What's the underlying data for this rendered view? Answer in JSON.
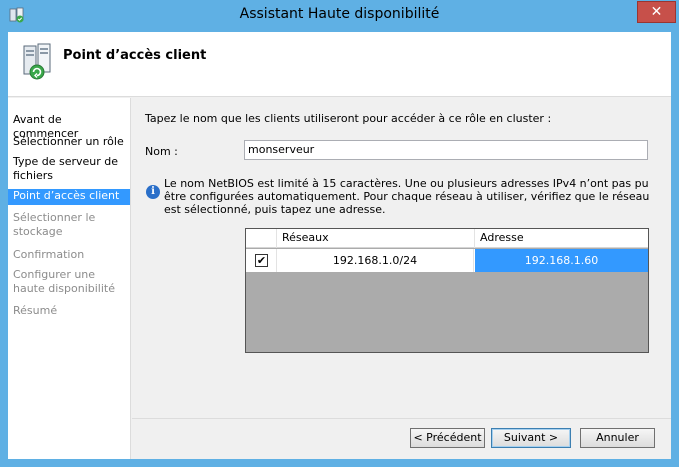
{
  "window": {
    "title": "Assistant Haute disponibilité",
    "close_glyph": "✕"
  },
  "header": {
    "title": "Point d’accès client",
    "icon": "cluster-server-icon"
  },
  "nav": {
    "items": [
      {
        "label": "Avant de commencer",
        "state": "done"
      },
      {
        "label": "Sélectionner un rôle",
        "state": "done"
      },
      {
        "label": "Type de serveur de fichiers",
        "state": "done"
      },
      {
        "label": "Point d’accès client",
        "state": "active"
      },
      {
        "label": "Sélectionner le stockage",
        "state": "disabled"
      },
      {
        "label": "Confirmation",
        "state": "disabled"
      },
      {
        "label": "Configurer une haute disponibilité",
        "state": "disabled"
      },
      {
        "label": "Résumé",
        "state": "disabled"
      }
    ]
  },
  "content": {
    "intro": "Tapez le nom que les clients utiliseront pour accéder à ce rôle en cluster :",
    "name_label": "Nom :",
    "name_value": "monserveur",
    "info_glyph": "i",
    "info_text": "Le nom NetBIOS est limité à 15 caractères.  Une ou plusieurs adresses IPv4 n’ont pas pu être configurées automatiquement. Pour chaque réseau à utiliser, vérifiez que le réseau est sélectionné, puis tapez une adresse.",
    "grid": {
      "columns": [
        "Réseaux",
        "Adresse"
      ],
      "rows": [
        {
          "checked": true,
          "check_glyph": "✔",
          "network": "192.168.1.0/24",
          "address": "192.168.1.60"
        }
      ]
    }
  },
  "footer": {
    "previous_label": "< Précédent",
    "next_label": "Suivant >",
    "cancel_label": "Annuler"
  },
  "colors": {
    "accent": "#3399ff",
    "title_bar": "#5fb0e4",
    "close": "#c7504a"
  }
}
